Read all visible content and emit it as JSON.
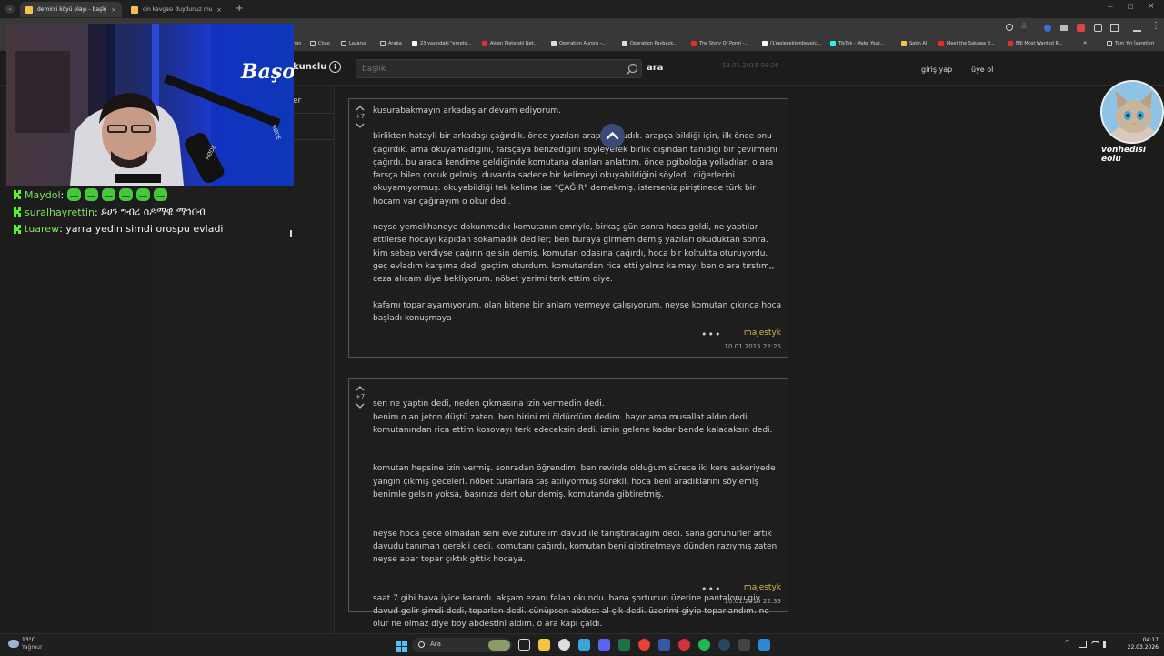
{
  "browser": {
    "tabs": [
      {
        "label": "demirci köyü olayı - başlığı açan",
        "active": true
      },
      {
        "label": "cin kavgası duydunuz mu hiç -",
        "active": false
      }
    ],
    "new_tab": "+",
    "window_controls": [
      "—",
      "□",
      "×"
    ],
    "bookmarks": [
      {
        "label": "nan",
        "color": "#888888"
      },
      {
        "label": "Chao",
        "color": "#cccccc"
      },
      {
        "label": "Lazarus",
        "color": "#cccccc"
      },
      {
        "label": "Araba",
        "color": "#cccccc"
      },
      {
        "label": "23 yaşındaki \"empto...",
        "color": "#ffffff"
      },
      {
        "label": "Aiden Pleterski Net...",
        "color": "#e03030"
      },
      {
        "label": "Operation Aurora -...",
        "color": "#dddddd"
      },
      {
        "label": "Operation Payback...",
        "color": "#dddddd"
      },
      {
        "label": "The Story Of Ponzi -...",
        "color": "#e52d27"
      },
      {
        "label": "(1)gelecektenbeyoic...",
        "color": "#ffffff"
      },
      {
        "label": "TikTok - Make Your...",
        "color": "#25f4ee"
      },
      {
        "label": "Satın Al",
        "color": "#f2c14e"
      },
      {
        "label": "Meet the Sakawa B...",
        "color": "#e52d27"
      },
      {
        "label": "FBI Most Wanted R...",
        "color": "#e52d27"
      },
      {
        "label": "»",
        "color": ""
      },
      {
        "label": "Tüm Yer İşaretleri",
        "color": "#cccccc"
      }
    ]
  },
  "site": {
    "brand": "kunclu",
    "search_placeholder": "başlık",
    "search_label": "ara",
    "faded_date": "18.01.2015 08:26",
    "login": "giriş yap",
    "signup": "üye ol",
    "left_fragment": "er"
  },
  "entries": [
    {
      "score": "+7",
      "paragraphs": [
        "kusurabakmayın arkadaşlar devam ediyorum.",
        "birlikten hatayli bir arkadaşı çağırdık. önce yazıları arapça okudık. arapça bildiği için, ilk önce onu çağırdık. ama okuyamadığını, farsçaya benzediğini söyleyerek birlik dışından tanıdığı bir çevirmeni çağırdı. bu arada kendime geldiğinde komutana olanları anlattım. önce pgiboloğa yolladılar, o ara farsça bilen çocuk gelmiş. duvarda sadece bir kelimeyi okuyabildiğini söyledi. diğerlerini okuyamıyormuş. okuyabildiği tek kelime ise \"ÇAĞIR\" demekmiş. isterseniz piriştinede türk bir hocam var çağırayım o okur dedi.",
        "neyse yemekhaneye dokunmadık komutanın emriyle, birkaç gün sonra hoca geldi, ne yaptılar ettilerse hocayı kapıdan sokamadık dediler; ben buraya girmem demiş yazıları okuduktan sonra. kim sebep verdiyse çağırın gelsin demiş. komutan odasına çağırdı, hoca bir koltukta oturuyordu. geç evladım karşıma dedi geçtim oturdum. komutandan rica etti yalnız kalmayı ben o ara tırstım,, ceza alıcam diye bekliyorum. nöbet yerimi terk ettim diye.",
        "kafamı toparlayamıyorum, olan bitene bir anlam vermeye çalışıyorum. neyse komutan çıkınca hoca başladı konuşmaya"
      ],
      "author": "majestyk",
      "date": "10.01.2015 22:25"
    },
    {
      "score": "+7",
      "paragraphs": [
        "sen ne yaptın dedi, neden çıkmasına izin vermedin dedi.\nbenim o an jeton düştü zaten. ben birini mi öldürdüm dedim. hayır ama musallat aldın dedi. komutanından rica ettim kosovayı terk edeceksin dedi. iznin gelene kadar bende kalacaksın dedi.",
        "komutan hepsine izin vermiş. sonradan öğrendim, ben revirde olduğum sürece iki kere askeriyede yangın çıkmış geceleri. nöbet tutanlara taş atılıyormuş sürekli. hoca beni aradıklarını söylemiş benimle gelsin yoksa, başınıza dert olur demiş. komutanda gibtiretmiş.",
        "neyse hoca gece olmadan seni eve zütürelim davud ile tanıştıracağım dedi. sana görünürler artık davudu tanıman gerekli dedi. komutanı çağırdı, komutan beni gibtiretmeye dünden razıymış zaten. neyse apar topar çıktık gittik hocaya.",
        "saat 7 gibi hava iyice karardı. akşam ezanı falan okundu. bana şortunun üzerine pantalonu giy davud gelir şimdi dedi, toparlan dedi. cünüpsen abdest al çık dedi. üzerimi giyip toparlandım. ne olur ne olmaz diye boy abdestini aldım. o ara kapı çaldı."
      ],
      "author": "majestyk",
      "date": "10.01.2015 22:33"
    }
  ],
  "chat": [
    {
      "user": "Maydol",
      "text": "",
      "emotes": 6
    },
    {
      "user": "suralhayrettin",
      "text": "ይሀን ግብረ ሰዶማዊ ማኅበብ",
      "emotes": 0
    },
    {
      "user": "tuarew",
      "text": "yarra yedin simdi orospu evladi",
      "emotes": 0
    }
  ],
  "webcam": {
    "logo": "Başo",
    "mic_brand": "RØDE"
  },
  "cat_label": "vonhedisi eolu",
  "taskbar": {
    "weather_temp": "13°C",
    "weather_desc": "Yağmur",
    "search": "Ara",
    "time": "04:17",
    "date": "22.03.2026"
  }
}
